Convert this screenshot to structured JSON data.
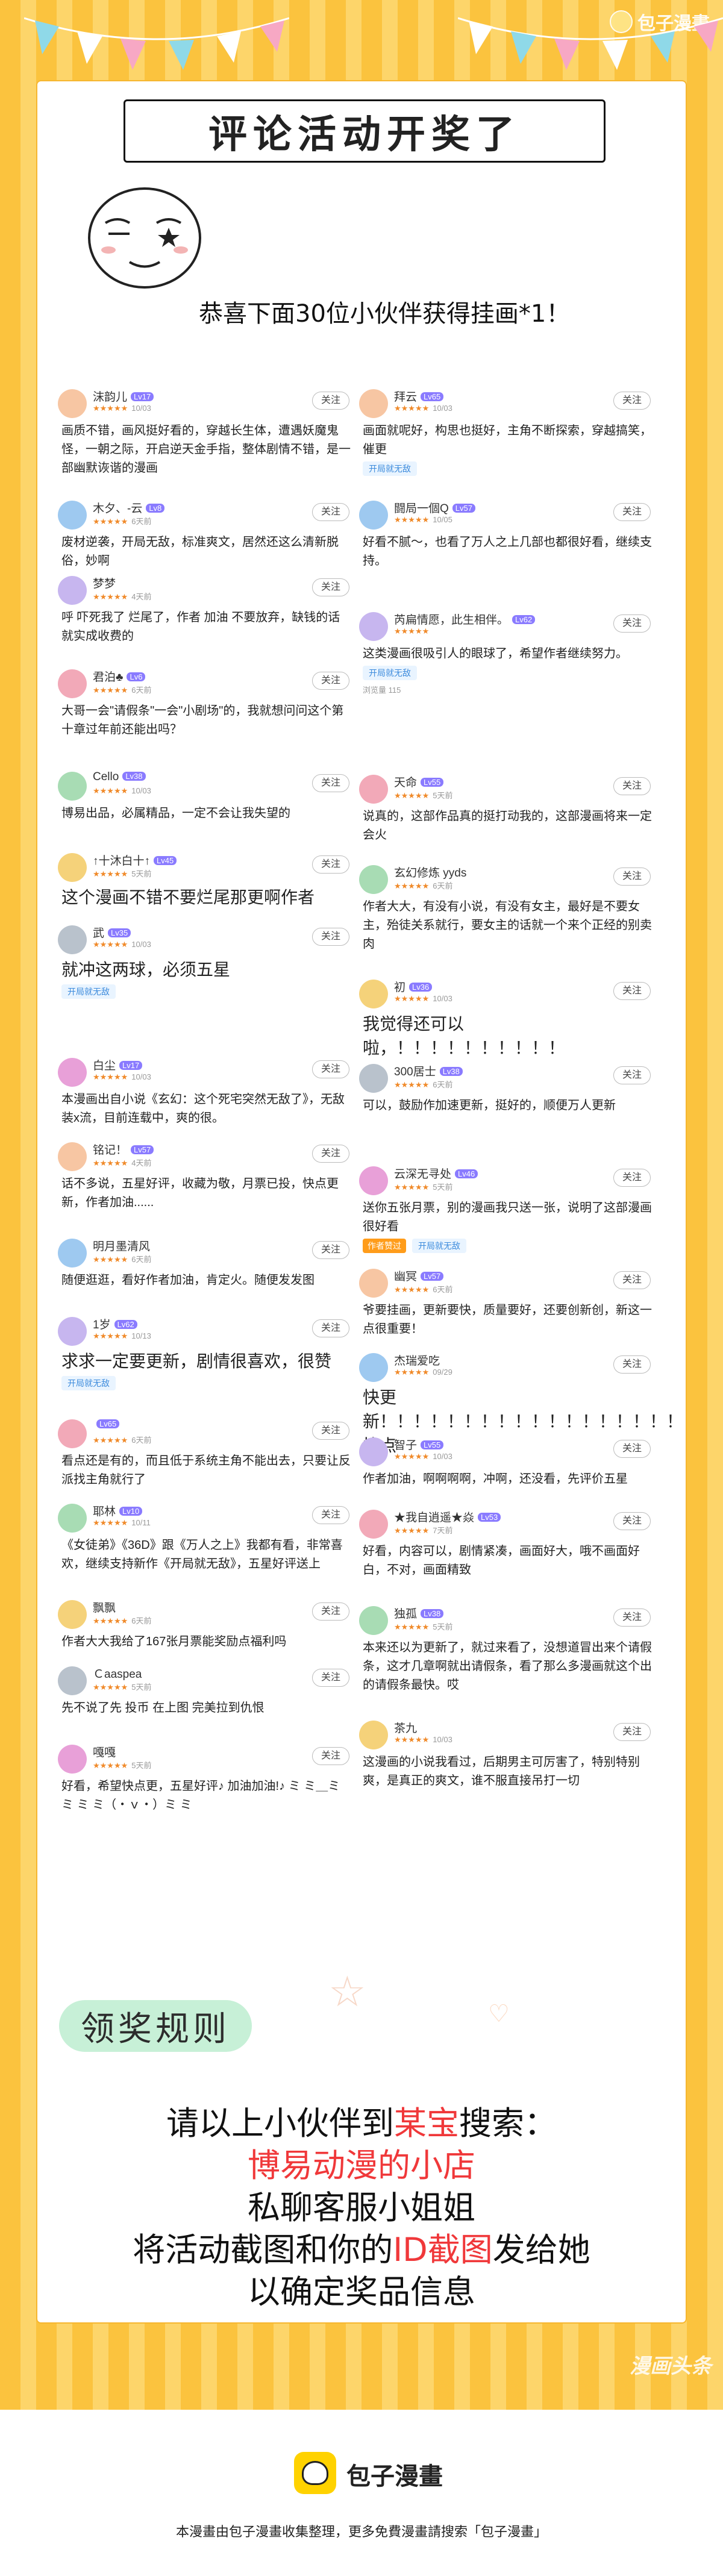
{
  "brand_watermark": "包子漫畫",
  "title": "评论活动开奖了",
  "subtitle": "恭喜下面30位小伙伴获得挂画*1！",
  "follow_label": "关注",
  "comments_left": [
    {
      "name": "沫韵儿",
      "level": "Lv17",
      "date": "10/03",
      "text": "画质不错，画风挺好看的，穿越长生体，遭遇妖魔鬼怪，一朝之际，开启逆天金手指，整体剧情不错，是一部幽默诙谐的漫画"
    },
    {
      "name": "木夕、-云",
      "level": "Lv8",
      "date": "6天前",
      "text": "废材逆袭，开局无敌，标准爽文，居然还这么清新脱俗，妙啊"
    },
    {
      "name": "梦梦",
      "level": "",
      "date": "4天前",
      "text": "呼 吓死我了 烂尾了，作者 加油 不要放弃，缺钱的话就实成收费的"
    },
    {
      "name": "君泊♣",
      "level": "Lv6",
      "date": "6天前",
      "text": "大哥一会\"请假条\"一会\"小剧场\"的，我就想问问这个第十章过年前还能出吗？"
    },
    {
      "name": "Cello",
      "level": "Lv38",
      "date": "10/03",
      "text": "博易出品，必属精品，一定不会让我失望的"
    },
    {
      "name": "↑十沐白十↑",
      "level": "Lv45",
      "date": "5天前",
      "text": "这个漫画不错不要烂尾那更啊作者"
    },
    {
      "name": "武",
      "level": "Lv35",
      "date": "10/03",
      "text": "就冲这两球，必须五星",
      "tag": "开局就无敌"
    },
    {
      "name": "白尘",
      "level": "Lv17",
      "date": "10/03",
      "text": "本漫画出自小说《玄幻：这个死宅突然无敌了》，无敌装x流，目前连载中，爽的很。"
    },
    {
      "name": "铭记！",
      "level": "Lv57",
      "date": "4天前",
      "text": "话不多说，五星好评，收藏为敬，月票已投，快点更新，作者加油......"
    },
    {
      "name": "明月墨清风",
      "level": "",
      "date": "6天前",
      "text": "随便逛逛，看好作者加油，肯定火。随便发发图"
    },
    {
      "name": "1岁",
      "level": "Lv62",
      "date": "10/13",
      "text": "求求一定要更新，剧情很喜欢，很赞",
      "tag": "开局就无敌"
    },
    {
      "name": "",
      "level": "Lv65",
      "date": "6天前",
      "text": "看点还是有的，而且低于系统主角不能出去，只要让反派找主角就行了"
    },
    {
      "name": "耶林",
      "level": "Lv10",
      "date": "10/11",
      "text": "《女徒弟》《36D》跟《万人之上》我都有看，非常喜欢，继续支持新作《开局就无敌》，五星好评送上"
    },
    {
      "name": "飘飘",
      "level": "",
      "date": "6天前",
      "text": "作者大大我给了167张月票能奖励点福利吗"
    },
    {
      "name": "Ｃaaspea",
      "level": "",
      "date": "5天前",
      "text": "先不说了先 投币 在上图 完美拉到仇恨"
    },
    {
      "name": "嘎嘎",
      "level": "",
      "date": "5天前",
      "text": "好看，希望快点更，五星好评♪ 加油加油!♪  ミ ミ＿ミ ミ  ミ ミ（・ｖ・）ミ ミ"
    }
  ],
  "comments_right": [
    {
      "name": "拜云",
      "level": "Lv65",
      "date": "10/03",
      "text": "画面就呢好，构思也挺好，主角不断探索，穿越搞笑，催更",
      "tag": "开局就无敌"
    },
    {
      "name": "闘局一個Q",
      "level": "Lv57",
      "date": "10/05",
      "text": "好看不腻～，也看了万人之上几部也都很好看，继续支持。"
    },
    {
      "name": "芮扁情愿，此生相伴。",
      "level": "Lv62",
      "date": "",
      "text": "这类漫画很吸引人的眼球了，希望作者继续努力。",
      "tag": "开局就无敌",
      "meta": "浏览量 115"
    },
    {
      "name": "天命",
      "level": "Lv55",
      "date": "5天前",
      "text": "说真的，这部作品真的挺打动我的，这部漫画将来一定会火"
    },
    {
      "name": "玄幻修炼 yyds",
      "level": "",
      "date": "6天前",
      "text": "作者大大，有没有小说，有没有女主，最好是不要女主，殆徒关系就行，要女主的话就一个来个正经的别卖肉"
    },
    {
      "name": "初",
      "level": "Lv36",
      "date": "10/03",
      "text": "我觉得还可以啦，！！！！！！！！！！"
    },
    {
      "name": "300居士",
      "level": "Lv38",
      "date": "6天前",
      "text": "可以，鼓励作加速更新，挺好的，顺便万人更新"
    },
    {
      "name": "云深无寻处",
      "level": "Lv46",
      "date": "5天前",
      "text": "送你五张月票，别的漫画我只送一张，说明了这部漫画很好看",
      "tag2": "作者赞过",
      "tag": "开局就无敌"
    },
    {
      "name": "幽冥",
      "level": "Lv57",
      "date": "6天前",
      "text": "爷要挂画，更新要快，质量要好，还要创新创，新这一点很重要！"
    },
    {
      "name": "杰瑞爱吃",
      "level": "",
      "date": "09/29",
      "text": "快更新！！！！！！！！！！！！！！！！！！快点"
    },
    {
      "name": "智子",
      "level": "Lv55",
      "date": "10/03",
      "text": "作者加油，啊啊啊啊，冲啊，还没看，先评价五星"
    },
    {
      "name": "★我自逍遥★焱",
      "level": "Lv53",
      "date": "7天前",
      "text": "好看，内容可以，剧情紧凑，画面好大，哦不画面好白，不对，画面精致"
    },
    {
      "name": "独孤",
      "level": "Lv38",
      "date": "5天前",
      "text": "本来还以为更新了，就过来看了，没想道冒出来个请假条，这才几章啊就出请假条，看了那么多漫画就这个出的请假条最快。哎"
    },
    {
      "name": "茶九",
      "level": "",
      "date": "10/03",
      "text": "这漫画的小说我看过，后期男主可厉害了，特别特别爽，是真正的爽文，谁不服直接吊打一切"
    }
  ],
  "rules_label": "领奖规则",
  "rules": {
    "l1a": "请以上小伙伴到",
    "l1b": "某宝",
    "l1c": "搜索：",
    "l2": "博易动漫的小店",
    "l3": "私聊客服小姐姐",
    "l4a": "将活动截图和你的",
    "l4b": "ID截图",
    "l4c": "发给她",
    "l5": "以确定奖品信息"
  },
  "watermark": "漫画头条",
  "footer": {
    "brand": "包子漫畫",
    "note": "本漫畫由包子漫畫收集整理，更多免費漫畫請搜索「包子漫畫」"
  }
}
